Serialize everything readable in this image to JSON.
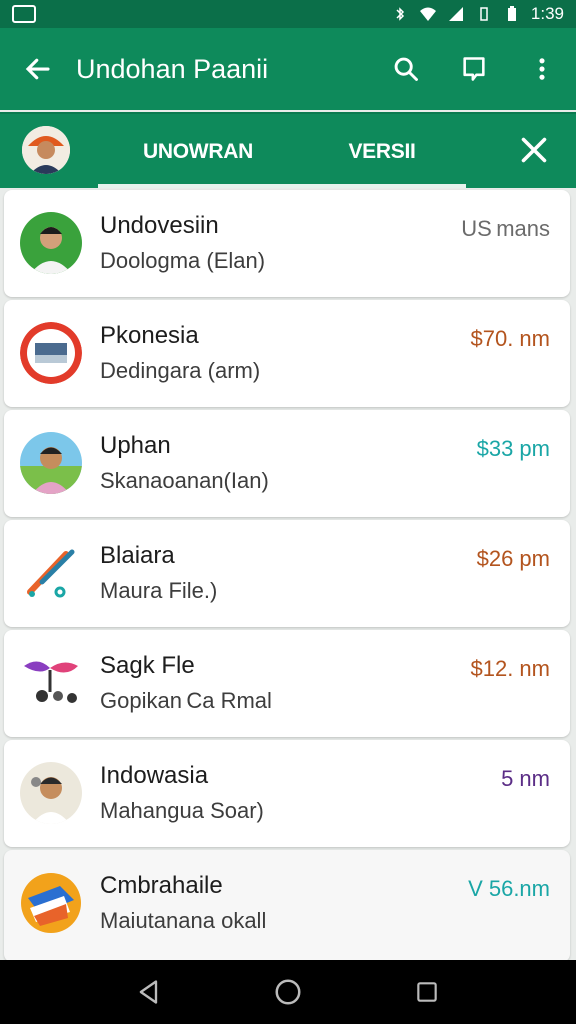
{
  "status": {
    "time": "1:39"
  },
  "appbar": {
    "title": "Undohan Paanii"
  },
  "tabs": [
    {
      "label": "UNOWRAN"
    },
    {
      "label": "VERSII"
    }
  ],
  "rows": [
    {
      "name": "Undovesiin",
      "sub": "Doologma (Elan)",
      "price": "US mans",
      "price_color": "#6b6b6b",
      "icon": "person-avatar-green"
    },
    {
      "name": "Pkonesia",
      "sub": "Dedingara (arm)",
      "price": "$70. nm",
      "price_color": "#b3541e",
      "icon": "red-screen-badge"
    },
    {
      "name": "Uphan",
      "sub": "Skanaoanan(Ian)",
      "price": "$33 pm",
      "price_color": "#1aa6a6",
      "icon": "person-avatar-landscape"
    },
    {
      "name": "Blaiara",
      "sub": "Maura File.)",
      "price": "$26 pm",
      "price_color": "#b3541e",
      "icon": "brush-tools-icon"
    },
    {
      "name": "Sagk Fle",
      "sub": "Gopikan Ca Rmal",
      "price": "$12. nm",
      "price_color": "#b3541e",
      "icon": "colorful-tools-icon"
    },
    {
      "name": "Indowasia",
      "sub": "Mahangua Soar)",
      "price": "5 nm",
      "price_color": "#5b2d86",
      "icon": "person-avatar-light"
    },
    {
      "name": "Cmbrahaile",
      "sub": "Maiutanana okall",
      "price": "V 56.nm",
      "price_color": "#1aa6a6",
      "icon": "orange-blue-logo"
    }
  ]
}
